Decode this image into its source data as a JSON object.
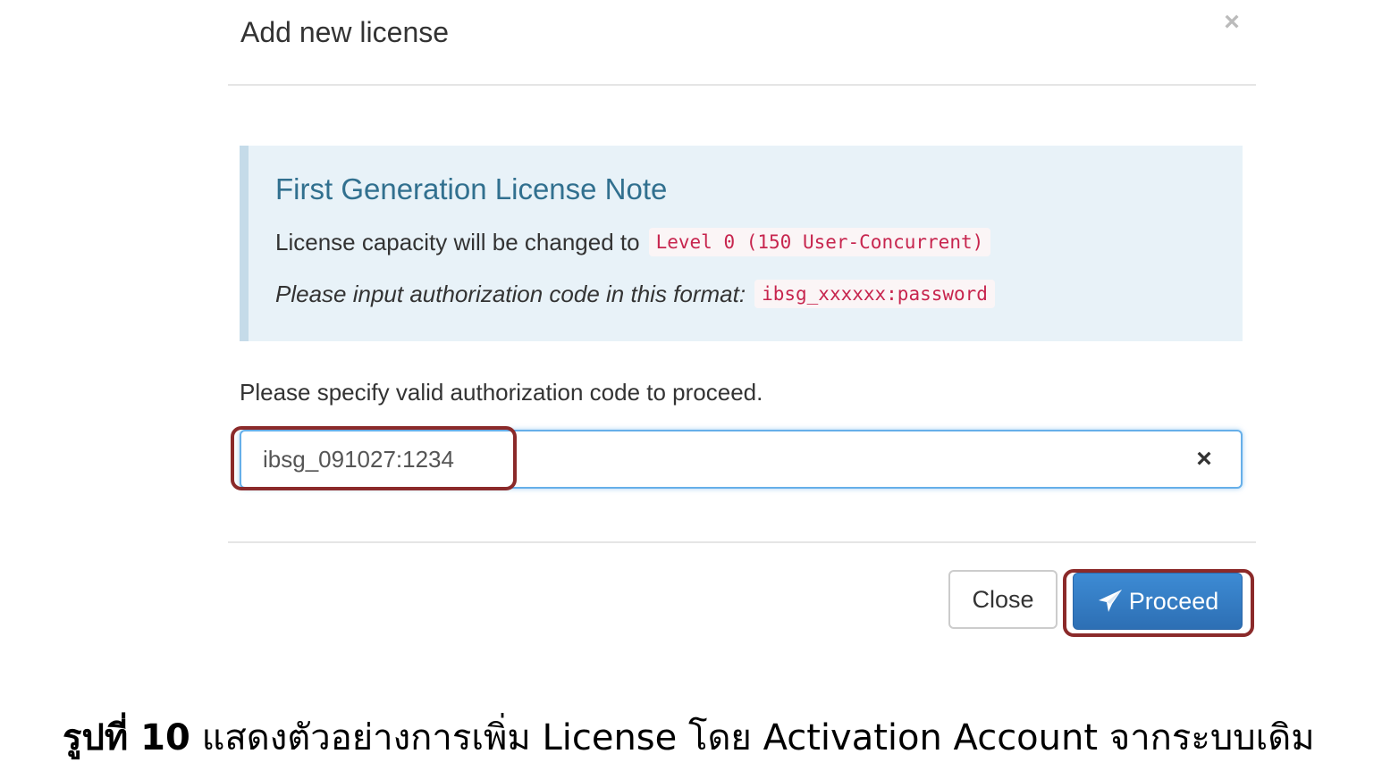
{
  "dialog": {
    "title": "Add new license",
    "close_icon": "times-icon"
  },
  "note": {
    "title": "First Generation License Note",
    "line1_text": "License capacity will be changed to",
    "line1_code": "Level 0 (150 User-Concurrent)",
    "line2_text": "Please input authorization code in this format:",
    "line2_code": "ibsg_xxxxxx:password"
  },
  "form": {
    "hint": "Please specify valid authorization code to proceed.",
    "auth_code_value": "ibsg_091027:1234",
    "clear_icon": "times-icon"
  },
  "footer": {
    "close_label": "Close",
    "proceed_label": "Proceed",
    "proceed_icon": "paper-plane-icon"
  },
  "caption": {
    "label": "รูปที่ 10",
    "text": "แสดงตัวอย่างการเพิ่ม License โดย Activation Account จากระบบเดิม"
  },
  "colors": {
    "note_bg": "#e8f2f8",
    "note_title": "#31708f",
    "code_text": "#c7254e",
    "primary": "#337ab7",
    "annotation_border": "#8b2a2a"
  }
}
